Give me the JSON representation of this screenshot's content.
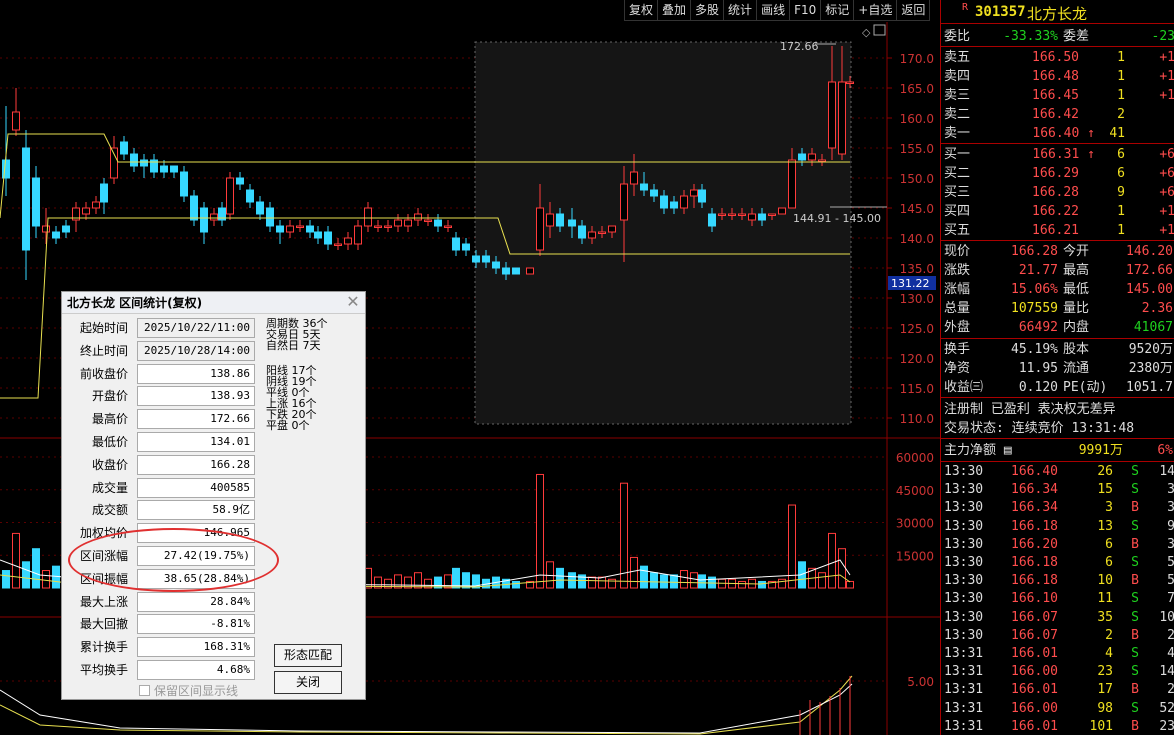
{
  "toolbar": [
    "复权",
    "叠加",
    "多股",
    "统计",
    "画线",
    "F10",
    "标记",
    "+自选",
    "返回"
  ],
  "stock": {
    "flag": "R",
    "code": "301357",
    "name": "北方长龙"
  },
  "quote": {
    "weibi_label": "委比",
    "weibi": "-33.33%",
    "weicha_label": "委差",
    "weicha": "-23",
    "asks": [
      {
        "label": "卖五",
        "price": "166.50",
        "vol": "1",
        "chg": "+1"
      },
      {
        "label": "卖四",
        "price": "166.48",
        "vol": "1",
        "chg": "+1"
      },
      {
        "label": "卖三",
        "price": "166.45",
        "vol": "1",
        "chg": "+1"
      },
      {
        "label": "卖二",
        "price": "166.42",
        "vol": "2",
        "chg": ""
      },
      {
        "label": "卖一",
        "price": "166.40",
        "vol": "41",
        "chg": "",
        "arrow": "↑"
      }
    ],
    "bids": [
      {
        "label": "买一",
        "price": "166.31",
        "vol": "6",
        "chg": "+6",
        "arrow": "↑"
      },
      {
        "label": "买二",
        "price": "166.29",
        "vol": "6",
        "chg": "+6"
      },
      {
        "label": "买三",
        "price": "166.28",
        "vol": "9",
        "chg": "+6"
      },
      {
        "label": "买四",
        "price": "166.22",
        "vol": "1",
        "chg": "+1"
      },
      {
        "label": "买五",
        "price": "166.21",
        "vol": "1",
        "chg": "+1"
      }
    ],
    "stats": [
      {
        "l1": "现价",
        "v1": "166.28",
        "c1": "up",
        "l2": "今开",
        "v2": "146.20",
        "c2": "up"
      },
      {
        "l1": "涨跌",
        "v1": "21.77",
        "c1": "up",
        "l2": "最高",
        "v2": "172.66",
        "c2": "up"
      },
      {
        "l1": "涨幅",
        "v1": "15.06%",
        "c1": "up",
        "l2": "最低",
        "v2": "145.00",
        "c2": "up"
      },
      {
        "l1": "总量",
        "v1": "107559",
        "c1": "yl",
        "l2": "量比",
        "v2": "2.36",
        "c2": "up"
      },
      {
        "l1": "外盘",
        "v1": "66492",
        "c1": "up",
        "l2": "内盘",
        "v2": "41067",
        "c2": "dn"
      }
    ],
    "stats2": [
      {
        "l1": "换手",
        "v1": "45.19%",
        "l2": "股本",
        "v2": "9520万"
      },
      {
        "l1": "净资",
        "v1": "11.95",
        "l2": "流通",
        "v2": "2380万"
      },
      {
        "l1": "收益㈢",
        "v1": "0.120",
        "l2": "PE(动)",
        "v2": "1051.7"
      }
    ],
    "notice": "注册制 已盈利 表决权无差异",
    "trade_status": "交易状态: 连续竞价 13:31:48",
    "main_force_label": "主力净额",
    "main_force_value": "9991万",
    "main_force_pct": "6%"
  },
  "ticks": [
    {
      "t": "13:30",
      "p": "166.40",
      "v": "26",
      "d": "S",
      "n": "14"
    },
    {
      "t": "13:30",
      "p": "166.34",
      "v": "15",
      "d": "S",
      "n": "3"
    },
    {
      "t": "13:30",
      "p": "166.34",
      "v": "3",
      "d": "B",
      "n": "3"
    },
    {
      "t": "13:30",
      "p": "166.18",
      "v": "13",
      "d": "S",
      "n": "9"
    },
    {
      "t": "13:30",
      "p": "166.20",
      "v": "6",
      "d": "B",
      "n": "3"
    },
    {
      "t": "13:30",
      "p": "166.18",
      "v": "6",
      "d": "S",
      "n": "5"
    },
    {
      "t": "13:30",
      "p": "166.18",
      "v": "10",
      "d": "B",
      "n": "5"
    },
    {
      "t": "13:30",
      "p": "166.10",
      "v": "11",
      "d": "S",
      "n": "7"
    },
    {
      "t": "13:30",
      "p": "166.07",
      "v": "35",
      "d": "S",
      "n": "10"
    },
    {
      "t": "13:30",
      "p": "166.07",
      "v": "2",
      "d": "B",
      "n": "2"
    },
    {
      "t": "13:31",
      "p": "166.01",
      "v": "4",
      "d": "S",
      "n": "4"
    },
    {
      "t": "13:31",
      "p": "166.00",
      "v": "23",
      "d": "S",
      "n": "14"
    },
    {
      "t": "13:31",
      "p": "166.01",
      "v": "17",
      "d": "B",
      "n": "2"
    },
    {
      "t": "13:31",
      "p": "166.00",
      "v": "98",
      "d": "S",
      "n": "52"
    },
    {
      "t": "13:31",
      "p": "166.01",
      "v": "101",
      "d": "B",
      "n": "23"
    }
  ],
  "chart": {
    "price_ticks": [
      "170.0",
      "165.0",
      "160.0",
      "155.0",
      "150.0",
      "145.0",
      "140.0",
      "135.0",
      "130.0",
      "125.0",
      "120.0",
      "115.0",
      "110.0"
    ],
    "price_values": [
      170,
      165,
      160,
      155,
      150,
      145,
      140,
      135,
      130,
      125,
      120,
      115,
      110
    ],
    "vol_ticks": [
      "60000",
      "45000",
      "30000",
      "15000"
    ],
    "vol_values": [
      60000,
      45000,
      30000,
      15000
    ],
    "ind_tick": "5.00",
    "high_label": "172.66",
    "low_label": "144.91 - 145.00",
    "cursor_price": "131.22",
    "yellow_line": "blue"
  },
  "dialog": {
    "title": "北方长龙 区间统计(复权)",
    "fields": [
      {
        "label": "起始时间",
        "value": "2025/10/22/11:00",
        "grey": true
      },
      {
        "label": "终止时间",
        "value": "2025/10/28/14:00",
        "grey": true
      },
      {
        "label": "前收盘价",
        "value": "138.86"
      },
      {
        "label": "开盘价",
        "value": "138.93"
      },
      {
        "label": "最高价",
        "value": "172.66"
      },
      {
        "label": "最低价",
        "value": "134.01"
      },
      {
        "label": "收盘价",
        "value": "166.28"
      },
      {
        "label": "成交量",
        "value": "400585"
      },
      {
        "label": "成交额",
        "value": "58.9亿"
      },
      {
        "label": "加权均价",
        "value": "146.965"
      },
      {
        "label": "区间涨幅",
        "value": "27.42(19.75%)"
      },
      {
        "label": "区间振幅",
        "value": "38.65(28.84%)"
      },
      {
        "label": "最大上涨",
        "value": "28.84%"
      },
      {
        "label": "最大回撤",
        "value": "-8.81%"
      },
      {
        "label": "累计换手",
        "value": "168.31%"
      },
      {
        "label": "平均换手",
        "value": "4.68%"
      }
    ],
    "stats": [
      "周期数 36个",
      "交易日 5天",
      "自然日 7天",
      "阳线 17个",
      "阴线 19个",
      "平线 0个",
      "上涨 16个",
      "下跌 20个",
      "平盘 0个"
    ],
    "btn_match": "形态匹配",
    "btn_close": "关闭",
    "checkbox": "保留区间显示线"
  }
}
